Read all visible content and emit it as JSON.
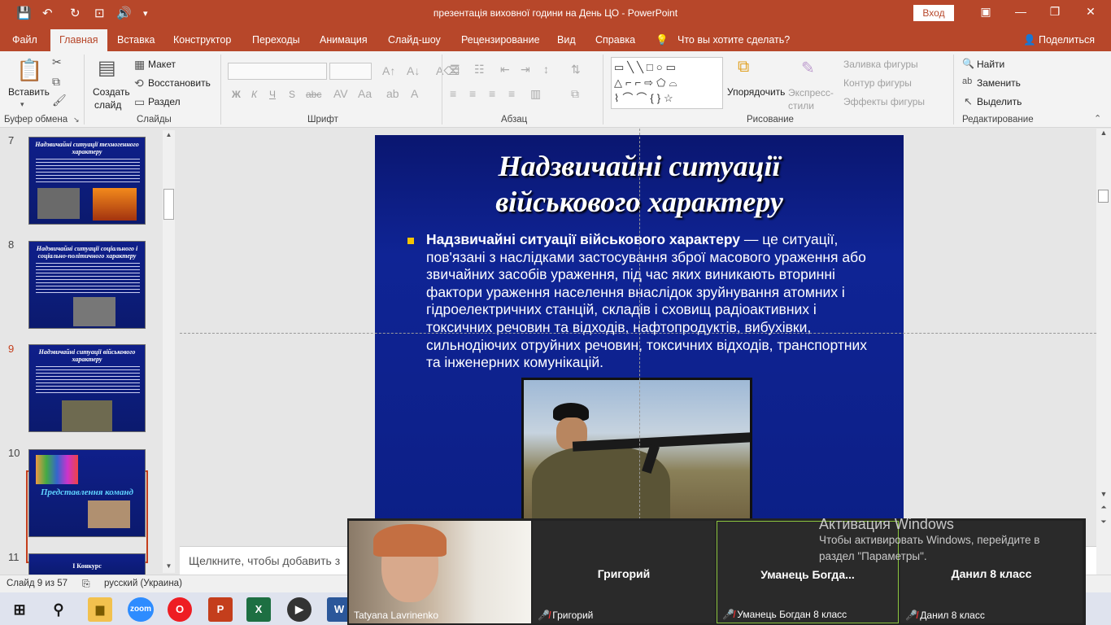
{
  "titlebar": {
    "title": "презентація виховної години на День ЦО  -  PowerPoint",
    "signin": "Вход"
  },
  "tabs": [
    "Файл",
    "Главная",
    "Вставка",
    "Конструктор",
    "Переходы",
    "Анимация",
    "Слайд-шоу",
    "Рецензирование",
    "Вид",
    "Справка",
    "Что вы хотите сделать?",
    "Поделиться"
  ],
  "ribbon": {
    "paste": "Вставить",
    "clipboard_label": "Буфер обмена",
    "create_slide": "Создать",
    "create_slide2": "слайд",
    "layout": "Макет",
    "reset": "Восстановить",
    "section": "Раздел",
    "slides_label": "Слайды",
    "font_label": "Шрифт",
    "font_buttons": [
      "Ж",
      "К",
      "Ч",
      "S",
      "abc"
    ],
    "paragraph_label": "Абзац",
    "arrange": "Упорядочить",
    "quick_styles": "Экспресс-стили",
    "shape_fill": "Заливка фигуры",
    "shape_outline": "Контур фигуры",
    "shape_effects": "Эффекты фигуры",
    "drawing_label": "Рисование",
    "find": "Найти",
    "replace": "Заменить",
    "select": "Выделить",
    "editing_label": "Редактирование"
  },
  "thumbnails": [
    {
      "num": "7",
      "title": "Надзвичайні ситуації техногенного характеру"
    },
    {
      "num": "8",
      "title": "Надзвичайні ситуації соціального і соціально-політичного характеру"
    },
    {
      "num": "9",
      "title": "Надзвичайні ситуації військового характеру"
    },
    {
      "num": "10",
      "title": "Представлення команд"
    },
    {
      "num": "11",
      "title": "I Конкурс"
    }
  ],
  "slide": {
    "title_line1": "Надзвичайні ситуації",
    "title_line2": "військового характеру",
    "body_bold": "Надзвичайні ситуації військового характеру",
    "body_rest": " — це ситуації, пов'язані з наслідками застосування зброї масового ураження або звичайних засобів ураження, під час яких виникають вторинні фактори ураження населення внаслідок зруйнування атомних і гідроелектричних станцій, складів і сховищ радіоактивних і токсичних речовин та відходів, нафтопродуктів, вибухівки, сильнодіючих отруйних речовин, токсичних відходів, транспортних та інженерних комунікацій."
  },
  "notes_placeholder": "Щелкните, чтобы добавить з",
  "status": {
    "slide_counter": "Слайд 9 из 57",
    "language": "русский (Украина)"
  },
  "zoom": {
    "tiles": [
      {
        "label": "Tatyana Lavrinenko"
      },
      {
        "name": "Григорий",
        "label": "Григорий"
      },
      {
        "name": "Уманець  Богда...",
        "label": "Уманець Богдан 8 класс"
      },
      {
        "name": "Данил 8 класс",
        "label": "Данил 8 класс"
      }
    ]
  },
  "activation": {
    "title": "Активация Windows",
    "line1": "Чтобы активировать Windows, перейдите в",
    "line2": "раздел \"Параметры\"."
  },
  "taskbar": {
    "zoom_label": "zoom"
  }
}
